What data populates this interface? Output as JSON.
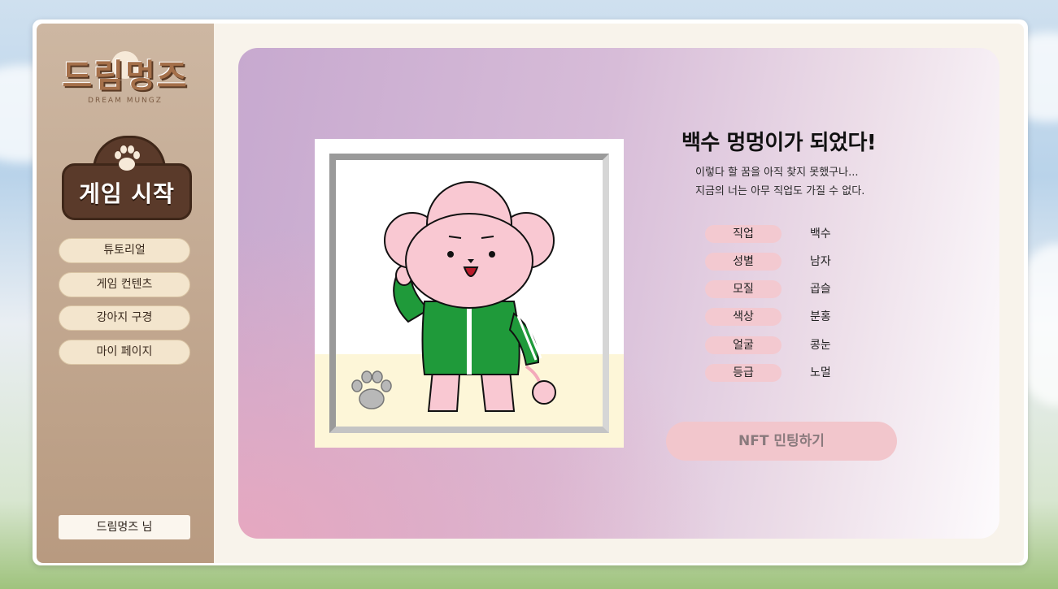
{
  "logo": {
    "text": "드림멍즈",
    "subtitle": "DREAM MUNGZ"
  },
  "game_start": {
    "label": "게임 시작"
  },
  "nav": [
    {
      "label": "튜토리얼"
    },
    {
      "label": "게임 컨텐츠"
    },
    {
      "label": "강아지 구경"
    },
    {
      "label": "마이 페이지"
    }
  ],
  "user": {
    "name": "드림멍즈 님"
  },
  "result": {
    "title": "백수 멍멍이가 되었다!",
    "desc_lines": [
      "이렇다 할 꿈을 아직 찾지 못했구나...",
      "지금의 너는 아무 직업도 가질 수 없다."
    ]
  },
  "stats": [
    {
      "label": "직업",
      "value": "백수"
    },
    {
      "label": "성별",
      "value": "남자"
    },
    {
      "label": "모질",
      "value": "곱슬"
    },
    {
      "label": "색상",
      "value": "분홍"
    },
    {
      "label": "얼굴",
      "value": "콩눈"
    },
    {
      "label": "등급",
      "value": "노멀"
    }
  ],
  "mint_button": {
    "label": "NFT 민팅하기"
  },
  "colors": {
    "sidebar": "#b89a80",
    "nav_button": "#f3e5cd",
    "stat_label": "#f3c9d0",
    "mint_button": "#f2c6cc",
    "jacket": "#1f9a3a",
    "dog_pink": "#f9c8d2"
  },
  "icons": [
    "paw-icon",
    "paw-icon",
    "paw-icon"
  ]
}
